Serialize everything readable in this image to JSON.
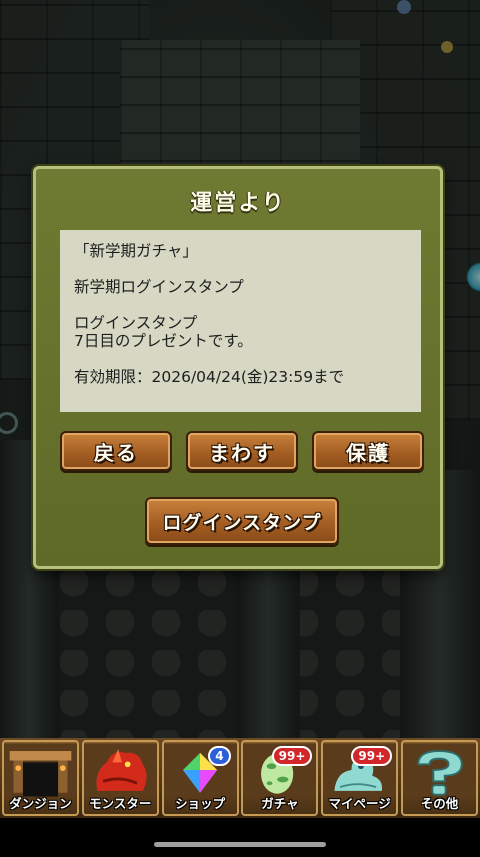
{
  "dialog": {
    "title": "運営より",
    "message": {
      "line1": "「新学期ガチャ」",
      "line2": "新学期ログインスタンプ",
      "line3": "ログインスタンプ",
      "line4": "7日目のプレゼントです。",
      "line5": "有効期限：2026/04/24(金)23:59まで"
    },
    "buttons": {
      "back": "戻る",
      "spin": "まわす",
      "protect": "保護",
      "login_stamp": "ログインスタンプ"
    }
  },
  "nav": {
    "items": [
      {
        "label": "ダンジョン",
        "icon": "dungeon-icon"
      },
      {
        "label": "モンスター",
        "icon": "monster-icon"
      },
      {
        "label": "ショップ",
        "icon": "shop-icon",
        "badge": "4"
      },
      {
        "label": "ガチャ",
        "icon": "gacha-egg-icon",
        "badge": "99+"
      },
      {
        "label": "マイページ",
        "icon": "mypage-icon",
        "badge": "99+"
      },
      {
        "label": "その他",
        "icon": "other-icon"
      }
    ]
  },
  "colors": {
    "dialog_bg": "#6f7a32",
    "dialog_border": "#b8bf7c",
    "message_bg": "#d6d8c3",
    "button_wood": "#a45e23",
    "badge_blue": "#2c5fd8",
    "badge_red": "#d1262a"
  }
}
